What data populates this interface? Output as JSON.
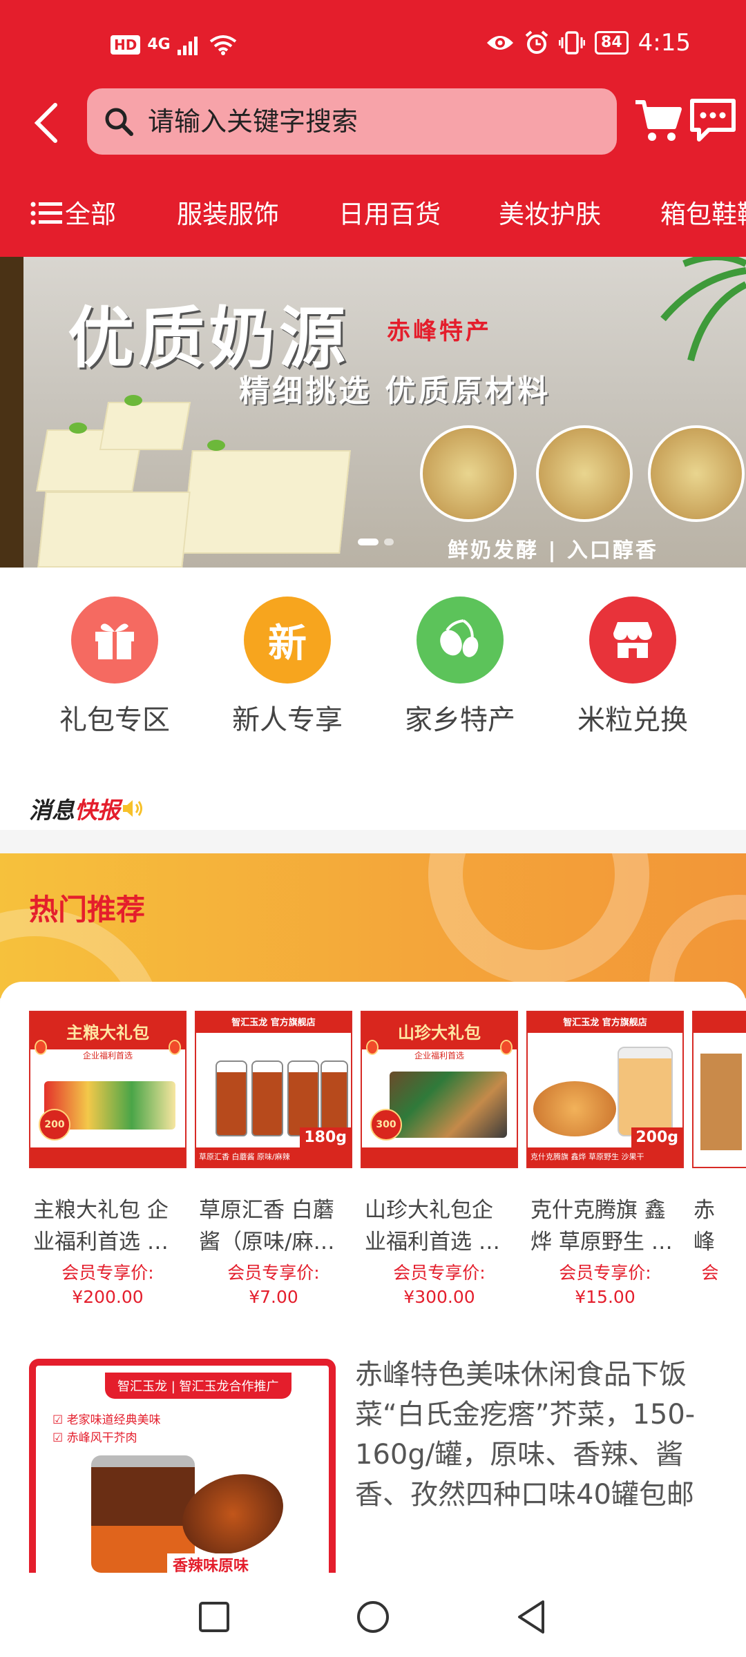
{
  "status_bar": {
    "hd": "HD",
    "network": "4G",
    "battery": "84",
    "time": "4:15"
  },
  "search": {
    "placeholder": "请输入关键字搜索"
  },
  "categories": [
    "全部",
    "服装服饰",
    "日用百货",
    "美妆护肤",
    "箱包鞋靴"
  ],
  "banner": {
    "title": "优质奶源",
    "tag": "赤峰特产",
    "subtitle": "精细挑选 优质原材料",
    "footer": "鲜奶发酵 | 入口醇香",
    "slides": 2,
    "active_slide": 1
  },
  "entries": [
    {
      "label": "礼包专区",
      "icon": "gift-icon",
      "color": "#f56a61",
      "glyph": ""
    },
    {
      "label": "新人专享",
      "icon": "new-user-icon",
      "color": "#f7a51e",
      "glyph": "新"
    },
    {
      "label": "家乡特产",
      "icon": "olive-icon",
      "color": "#5cc35a",
      "glyph": ""
    },
    {
      "label": "米粒兑换",
      "icon": "store-icon",
      "color": "#e8333a",
      "glyph": ""
    }
  ],
  "news": {
    "label_black": "消息",
    "label_red": "快报"
  },
  "hot": {
    "title": "热门推荐",
    "products": [
      {
        "name": "主粮大礼包 企业福利首选 …",
        "price_label": "会员专享价:",
        "price": "¥200.00",
        "img_title": "主粮大礼包",
        "img_badge": "200",
        "img_sub": "企业福利首选"
      },
      {
        "name": "草原汇香 白蘑酱（原味/麻…",
        "price_label": "会员专享价:",
        "price": "¥7.00",
        "img_title": "智汇玉龙 官方旗舰店",
        "img_weight": "180g",
        "img_sub": "草原汇香 白蘑酱 原味/麻辣"
      },
      {
        "name": "山珍大礼包企业福利首选 …",
        "price_label": "会员专享价:",
        "price": "¥300.00",
        "img_title": "山珍大礼包",
        "img_badge": "300",
        "img_sub": "企业福利首选"
      },
      {
        "name": "克什克腾旗 鑫烨 草原野生 …",
        "price_label": "会员专享价:",
        "price": "¥15.00",
        "img_title": "智汇玉龙 官方旗舰店",
        "img_weight": "200g",
        "img_sub": "克什克腾旗 鑫烨 草原野生 沙果干"
      },
      {
        "name": "赤峰特产土…",
        "price_label": "会",
        "price": "",
        "img_title": "",
        "img_sub": ""
      }
    ]
  },
  "feed": {
    "title": "赤峰特色美味休闲食品下饭菜“白氏金疙瘩”芥菜，150-160g/罐，原味、香辣、酱香、孜然四种口味40罐包邮",
    "img_brand": "智汇玉龙 | 智汇玉龙合作推广",
    "img_checks": [
      "老家味道经典美味",
      "赤峰风干芥肉"
    ],
    "img_tag": "香辣味原味"
  },
  "nav": [
    "recent-apps",
    "home",
    "back"
  ],
  "colors": {
    "brand_red": "#e41e2c",
    "hot_orange": "#f4a63a"
  }
}
